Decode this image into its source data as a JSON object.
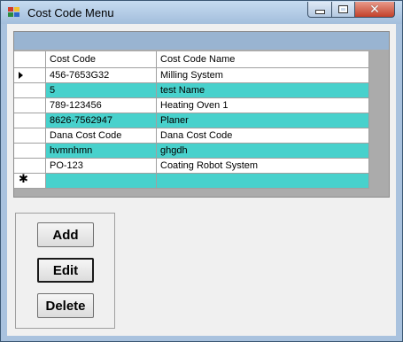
{
  "window": {
    "title": "Cost Code Menu"
  },
  "titlebar": {
    "minimize_icon": "minimize-icon",
    "maximize_icon": "maximize-icon",
    "close_glyph": "✕"
  },
  "grid": {
    "columns": [
      "Cost Code",
      "Cost Code Name"
    ],
    "rows": [
      [
        "456-7653G32",
        "Milling System"
      ],
      [
        "5",
        "test Name"
      ],
      [
        "789-123456",
        "Heating Oven 1"
      ],
      [
        "8626-7562947",
        "Planer"
      ],
      [
        "Dana Cost Code",
        "Dana Cost Code"
      ],
      [
        "hvmnhmn",
        "ghgdh"
      ],
      [
        "PO-123",
        "Coating Robot System"
      ],
      [
        "",
        ""
      ]
    ],
    "new_row_glyph": "✱",
    "colors": {
      "alt_row": "#48d1cc",
      "caption": "#99b4d1",
      "background": "#ababab"
    }
  },
  "buttons": {
    "add": "Add",
    "edit": "Edit",
    "delete": "Delete"
  }
}
